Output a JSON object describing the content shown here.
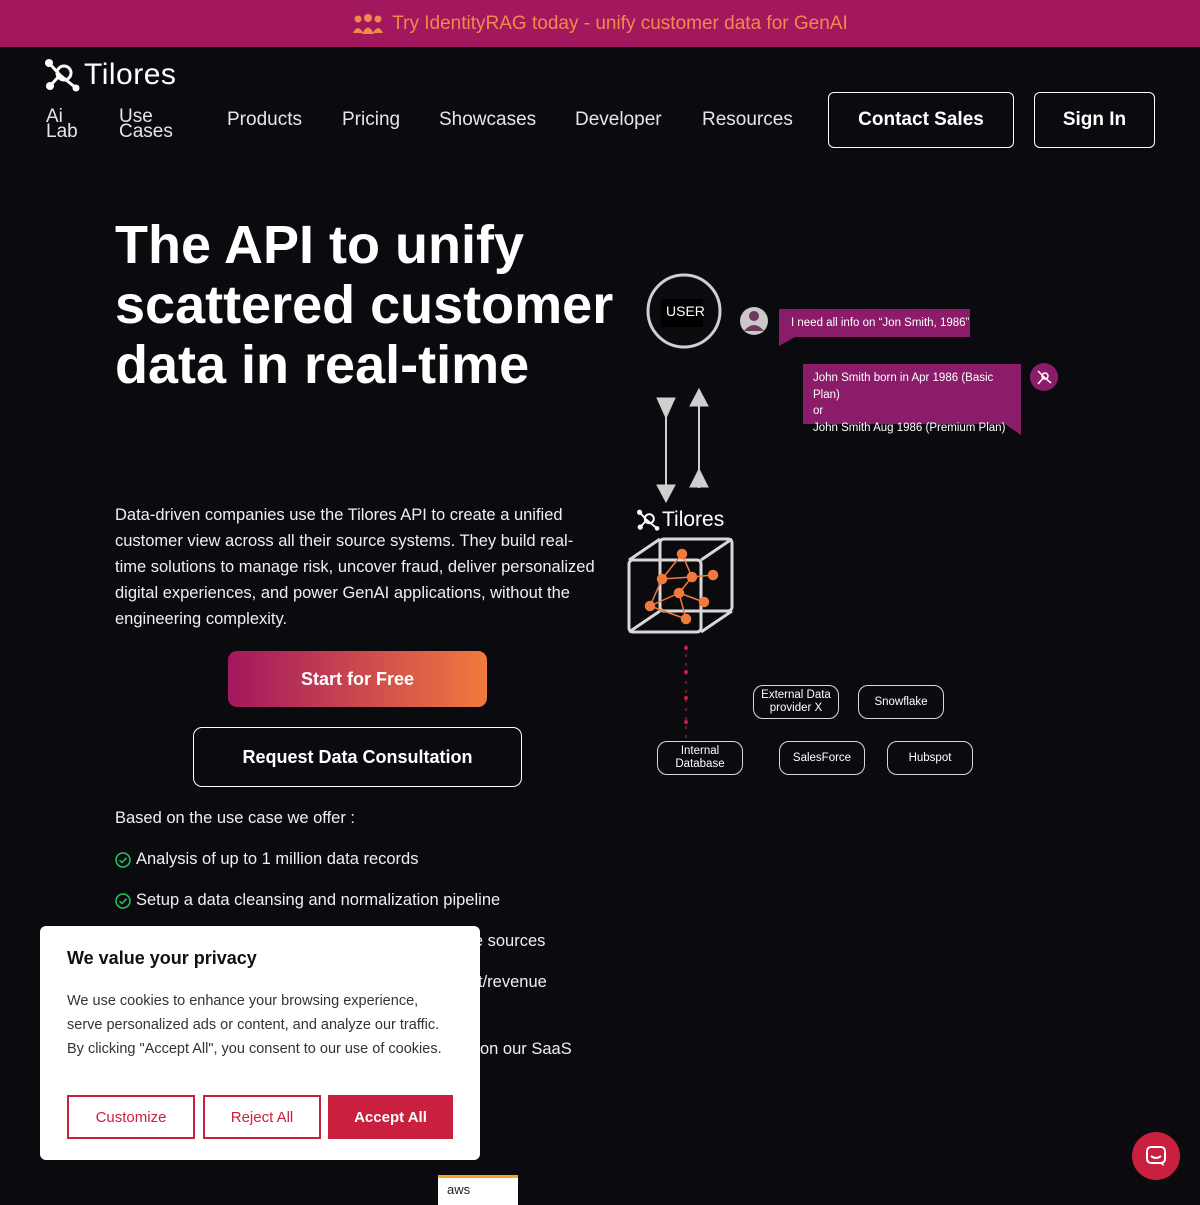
{
  "banner": {
    "text": "Try IdentityRAG today - unify customer data for GenAI",
    "icon": "people-icon"
  },
  "header": {
    "logo_text": "Tilores",
    "nav": {
      "ai_lab": [
        "Ai",
        "Lab"
      ],
      "use_cases": [
        "Use",
        "Cases"
      ],
      "products": "Products",
      "pricing": "Pricing",
      "showcases": "Showcases",
      "developer": "Developer",
      "resources": "Resources"
    },
    "contact_sales": "Contact Sales",
    "sign_in": "Sign In"
  },
  "hero": {
    "title": "The API to unify scattered customer data in real-time",
    "description": "Data-driven companies use the Tilores API to create a unified customer view across all their source systems. They build real-time solutions to manage risk, uncover fraud, deliver personalized digital experiences, and power GenAI applications, without the engineering complexity.",
    "start_button": "Start for Free",
    "consult_button": "Request Data Consultation",
    "offer_intro": "Based on the use case we offer :",
    "offers": [
      "Analysis of up to 1 million data records",
      "Setup a data cleansing and normalization pipeline",
      "ple sources",
      "t/revenue",
      "on our SaaS"
    ]
  },
  "diagram": {
    "user_label": "USER",
    "user_message": "I need all info on “Jon Smith, 1986”",
    "reply_lines": [
      "John Smith born in Apr 1986 (Basic Plan)",
      "or",
      "John Smith Aug 1986 (Premium Plan)"
    ],
    "logo_text": "Tilores",
    "sources": [
      "External Data provider X",
      "Snowflake",
      "Internal Database",
      "SalesForce",
      "Hubspot"
    ]
  },
  "cookie": {
    "title": "We value your privacy",
    "text": "We use cookies to enhance your browsing experience, serve personalized ads or content, and analyze our traffic. By clicking \"Accept All\", you consent to our use of cookies.",
    "customize": "Customize",
    "reject": "Reject All",
    "accept": "Accept All"
  },
  "badge": {
    "aws": "aws"
  },
  "colors": {
    "banner": "#a3175e",
    "accent": "#c8203e",
    "orange": "#f07a3e",
    "check": "#22c55e"
  }
}
